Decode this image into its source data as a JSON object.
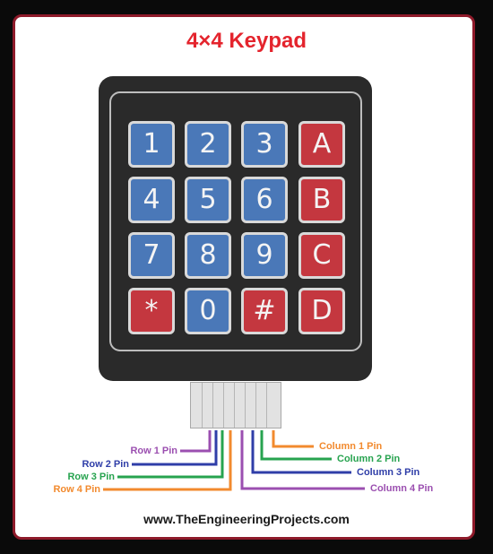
{
  "title": "4×4 Keypad",
  "footer": "www.TheEngineeringProjects.com",
  "keys": [
    [
      "1",
      "2",
      "3",
      "A"
    ],
    [
      "4",
      "5",
      "6",
      "B"
    ],
    [
      "7",
      "8",
      "9",
      "C"
    ],
    [
      "*",
      "0",
      "#",
      "D"
    ]
  ],
  "key_colors": {
    "number": "#4a78b8",
    "letter": "#c4373f"
  },
  "pins": {
    "row_1": {
      "label": "Row 1 Pin",
      "color": "#9b4fb0"
    },
    "row_2": {
      "label": "Row 2 Pin",
      "color": "#2f3ea8"
    },
    "row_3": {
      "label": "Row 3 Pin",
      "color": "#27a34f"
    },
    "row_4": {
      "label": "Row 4 Pin",
      "color": "#f28a2e"
    },
    "col_1": {
      "label": "Column 1 Pin",
      "color": "#f28a2e"
    },
    "col_2": {
      "label": "Column 2 Pin",
      "color": "#27a34f"
    },
    "col_3": {
      "label": "Column 3 Pin",
      "color": "#2f3ea8"
    },
    "col_4": {
      "label": "Column 4 Pin",
      "color": "#9b4fb0"
    }
  }
}
